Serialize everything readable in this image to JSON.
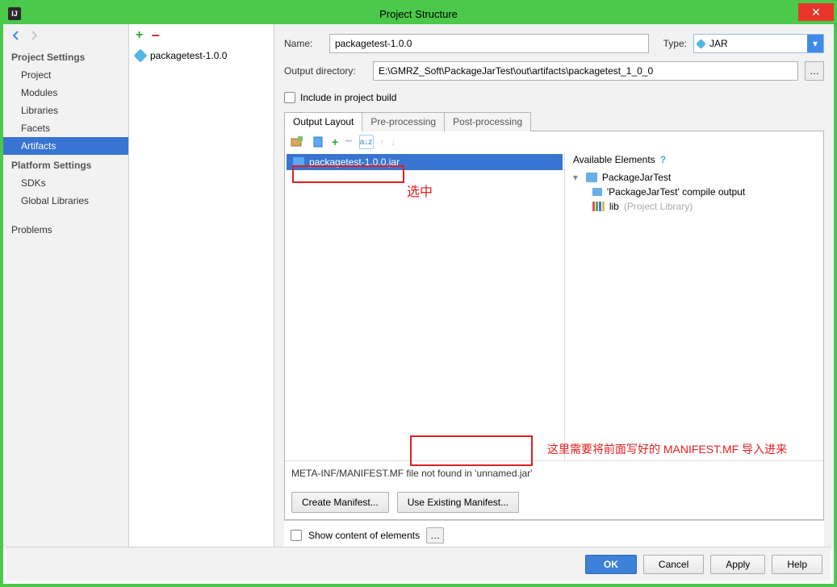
{
  "window": {
    "title": "Project Structure"
  },
  "sidebar": {
    "section1": "Project Settings",
    "items1": [
      "Project",
      "Modules",
      "Libraries",
      "Facets",
      "Artifacts"
    ],
    "selected1": "Artifacts",
    "section2": "Platform Settings",
    "items2": [
      "SDKs",
      "Global Libraries"
    ],
    "section3": "",
    "items3": [
      "Problems"
    ]
  },
  "artifact_list": {
    "item": "packagetest-1.0.0"
  },
  "form": {
    "name_label": "Name:",
    "name_value": "packagetest-1.0.0",
    "type_label": "Type:",
    "type_value": "JAR",
    "outdir_label": "Output directory:",
    "outdir_value": "E:\\GMRZ_Soft\\PackageJarTest\\out\\artifacts\\packagetest_1_0_0",
    "include_label": "Include in project build"
  },
  "tabs": [
    "Output Layout",
    "Pre-processing",
    "Post-processing"
  ],
  "layout": {
    "jar_name": "packagetest-1.0.0.jar",
    "available_title": "Available Elements",
    "tree": {
      "root": "PackageJarTest",
      "compile_output": "'PackageJarTest' compile output",
      "lib": "lib",
      "lib_note": "(Project Library)"
    },
    "status": "META-INF/MANIFEST.MF file not found in 'unnamed.jar'",
    "create_btn": "Create Manifest...",
    "use_btn": "Use Existing Manifest..."
  },
  "bottom": {
    "show_content": "Show content of elements"
  },
  "footer": {
    "ok": "OK",
    "cancel": "Cancel",
    "apply": "Apply",
    "help": "Help"
  },
  "annotations": {
    "selected": "选中",
    "import_note": "这里需要将前面写好的 MANIFEST.MF 导入进来"
  }
}
